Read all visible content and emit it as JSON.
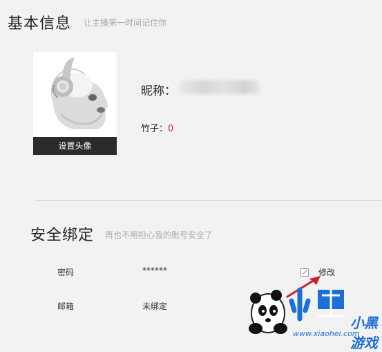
{
  "profile_section": {
    "title": "基本信息",
    "subtitle": "让主播第一时间记住你",
    "avatar_button": "设置头像",
    "nickname_label": "昵称：",
    "bamboo_label": "竹子：",
    "bamboo_value": "0"
  },
  "security_section": {
    "title": "安全绑定",
    "subtitle": "再也不用担心我的账号安全了",
    "password": {
      "label": "密码",
      "value": "******",
      "action": "修改"
    },
    "email": {
      "label": "邮箱",
      "value": "未绑定"
    }
  },
  "watermark": {
    "brand": "小黑游戏",
    "url": "www.xiaohei.com"
  },
  "colors": {
    "background": "#f2f2f2",
    "bamboo_value": "#e0242a",
    "avatar_button_bg": "#2b2b2b",
    "arrow": "#c8232a"
  }
}
